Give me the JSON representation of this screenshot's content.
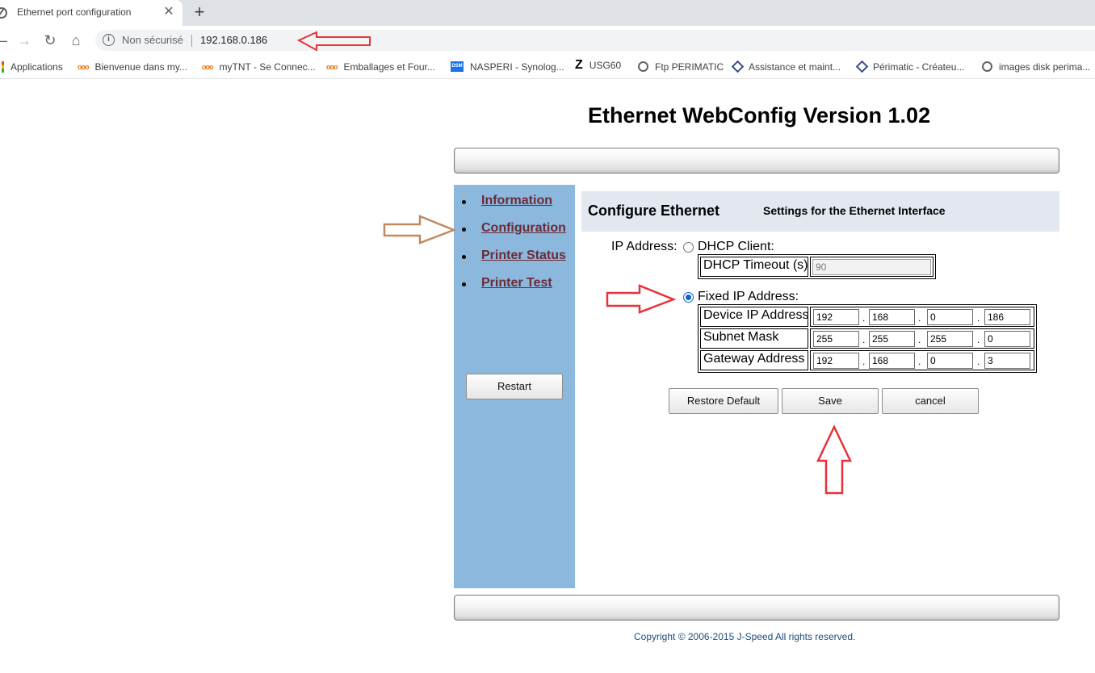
{
  "browser": {
    "tab_title": "Ethernet port configuration",
    "tab_close": "✕",
    "new_tab": "+",
    "security_label": "Non sécurisé",
    "url": "192.168.0.186",
    "bookmarks": [
      {
        "label": "Applications",
        "icon": "apps-icon"
      },
      {
        "label": "Bienvenue dans my...",
        "icon": "tnt-icon"
      },
      {
        "label": "myTNT - Se Connec...",
        "icon": "tnt-icon"
      },
      {
        "label": "Emballages et Four...",
        "icon": "tnt-icon"
      },
      {
        "label": "NASPERI - Synolog...",
        "icon": "dsm-icon"
      },
      {
        "label": "USG60",
        "icon": "z-icon"
      },
      {
        "label": "Ftp PERIMATIC",
        "icon": "globe-icon"
      },
      {
        "label": "Assistance et maint...",
        "icon": "diamond-icon"
      },
      {
        "label": "Périmatic - Créateu...",
        "icon": "diamond-icon"
      },
      {
        "label": "images disk perima...",
        "icon": "globe-icon"
      }
    ]
  },
  "page": {
    "title": "Ethernet WebConfig Version 1.02",
    "copyright": "Copyright © 2006-2015 J-Speed All rights reserved."
  },
  "sidebar": {
    "items": [
      {
        "label": "Information"
      },
      {
        "label": "Configuration"
      },
      {
        "label": "Printer Status"
      },
      {
        "label": "Printer Test"
      }
    ],
    "restart_label": "Restart",
    "color": "#8cb8de"
  },
  "config": {
    "title": "Configure Ethernet",
    "subtitle": "Settings for the Ethernet Interface",
    "ip_address_label": "IP Address:",
    "dhcp_label": "DHCP Client:",
    "dhcp_checked": false,
    "dhcp_timeout_label": "DHCP Timeout (s)",
    "dhcp_timeout_value": "90",
    "fixed_label": "Fixed IP Address:",
    "fixed_checked": true,
    "rows": [
      {
        "label": "Device IP Address",
        "octets": [
          "192",
          "168",
          "0",
          "186"
        ]
      },
      {
        "label": "Subnet Mask",
        "octets": [
          "255",
          "255",
          "255",
          "0"
        ]
      },
      {
        "label": "Gateway Address",
        "octets": [
          "192",
          "168",
          "0",
          "3"
        ]
      }
    ],
    "octet_separator": ".",
    "buttons": {
      "restore": "Restore Default",
      "save": "Save",
      "cancel": "cancel"
    }
  },
  "annotations": {
    "url_arrow_color": "#e8313a",
    "config_arrow_color": "#c08a62",
    "fixed_arrow_color": "#e8313a",
    "save_arrow_color": "#e8313a"
  }
}
